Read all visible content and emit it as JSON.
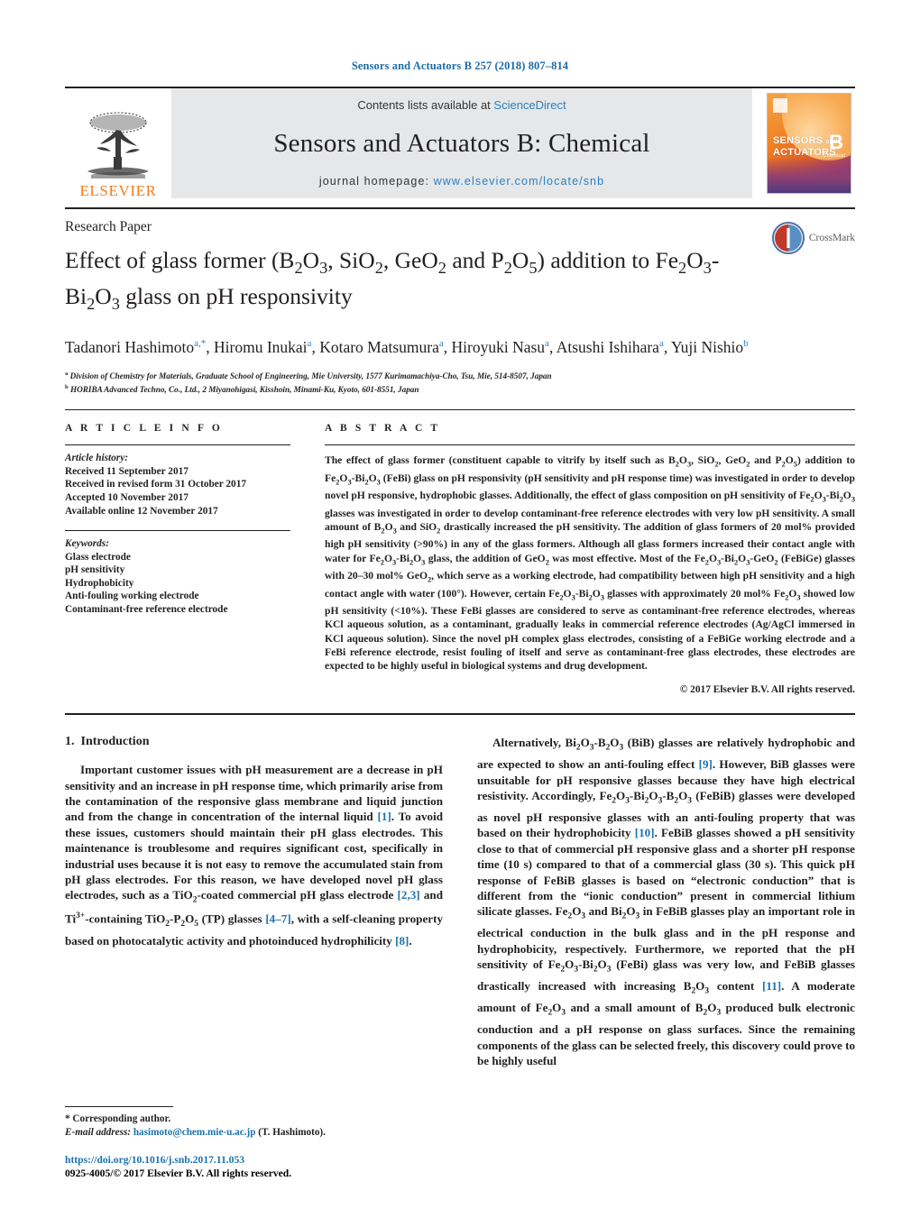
{
  "running_head": "Sensors and Actuators B 257 (2018) 807–814",
  "masthead": {
    "publisher_name": "ELSEVIER",
    "contents_prefix": "Contents lists available at ",
    "contents_link": "ScienceDirect",
    "journal_title": "Sensors and Actuators B: Chemical",
    "homepage_prefix": "journal homepage: ",
    "homepage_link": "www.elsevier.com/locate/snb",
    "cover": {
      "line1": "SENSORS",
      "line1_small": "and",
      "line2": "ACTUATORS",
      "letter": "B",
      "letter_sub": "Chemical"
    }
  },
  "article": {
    "type": "Research Paper",
    "title_line1_pre": "Effect of glass former (B",
    "title_full": "Effect of glass former (B2O3, SiO2, GeO2 and P2O5) addition to Fe2O3-Bi2O3 glass on pH responsivity",
    "authors_plain": "Tadanori Hashimoto a,*, Hiromu Inukai a, Kotaro Matsumura a, Hiroyuki Nasu a, Atsushi Ishihara a, Yuji Nishio b",
    "affiliation_a": "Division of Chemistry for Materials, Graduate School of Engineering, Mie University, 1577 Kurimamachiya-Cho, Tsu, Mie, 514-8507, Japan",
    "affiliation_b": "HORIBA Advanced Techno, Co., Ltd., 2 Miyanohigasi, Kisshoin, Minami-Ku, Kyoto, 601-8551, Japan",
    "crossmark_label": "CrossMark"
  },
  "article_info": {
    "heading": "A R T I C L E   I N F O",
    "history_label": "Article history:",
    "history": [
      "Received 11 September 2017",
      "Received in revised form 31 October 2017",
      "Accepted 10 November 2017",
      "Available online 12 November 2017"
    ],
    "keywords_label": "Keywords:",
    "keywords": [
      "Glass electrode",
      "pH sensitivity",
      "Hydrophobicity",
      "Anti-fouling working electrode",
      "Contaminant-free reference electrode"
    ]
  },
  "abstract": {
    "heading": "A B S T R A C T",
    "copyright": "© 2017 Elsevier B.V. All rights reserved."
  },
  "intro": {
    "number": "1.",
    "heading": "Introduction"
  },
  "footnote": {
    "corresponding": "* Corresponding author.",
    "email_label": "E-mail address:",
    "email": "hasimoto@chem.mie-u.ac.jp",
    "email_suffix": "(T. Hashimoto)."
  },
  "footer": {
    "doi": "https://doi.org/10.1016/j.snb.2017.11.053",
    "issn_line": "0925-4005/© 2017 Elsevier B.V. All rights reserved."
  },
  "colors": {
    "link": "#1b72b0",
    "running_head": "#1b6ca8",
    "elsevier_orange": "#ef7d23",
    "band_gray": "#e6e7e8"
  }
}
